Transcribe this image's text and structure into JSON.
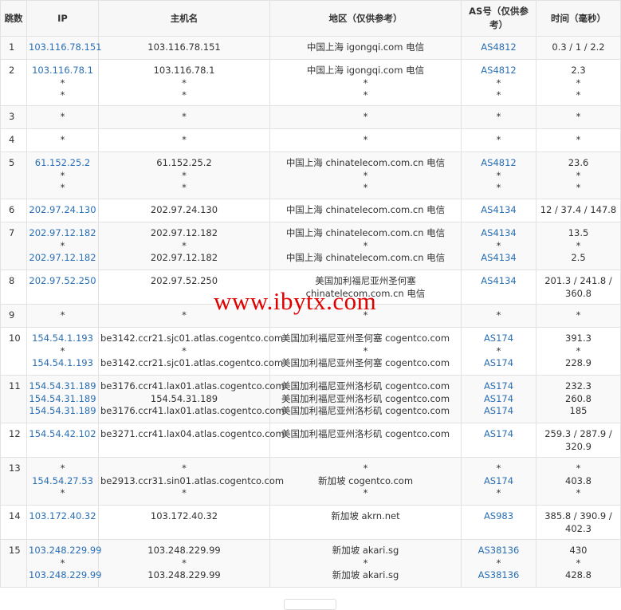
{
  "headers": {
    "hop": "跳数",
    "ip": "IP",
    "host": "主机名",
    "region": "地区（仅供参考）",
    "as": "AS号（仅供参考）",
    "time": "时间（毫秒）"
  },
  "rows": [
    {
      "hop": "1",
      "h": 29,
      "ip": [
        "103.116.78.151"
      ],
      "host": [
        "103.116.78.151"
      ],
      "region": [
        "中国上海 igongqi.com 电信"
      ],
      "as": [
        "AS4812"
      ],
      "time": [
        "0.3 / 1 / 2.2"
      ]
    },
    {
      "hop": "2",
      "h": 58,
      "ip": [
        "103.116.78.1",
        "*",
        "*"
      ],
      "host": [
        "103.116.78.1",
        "*",
        "*"
      ],
      "region": [
        "中国上海 igongqi.com 电信",
        "*",
        "*"
      ],
      "as": [
        "AS4812",
        "*",
        "*"
      ],
      "time": [
        "2.3",
        "*",
        "*"
      ]
    },
    {
      "hop": "3",
      "h": 29,
      "ip": [
        "*"
      ],
      "host": [
        "*"
      ],
      "region": [
        "*"
      ],
      "as": [
        "*"
      ],
      "time": [
        "*"
      ]
    },
    {
      "hop": "4",
      "h": 29,
      "ip": [
        "*"
      ],
      "host": [
        "*"
      ],
      "region": [
        "*"
      ],
      "as": [
        "*"
      ],
      "time": [
        "*"
      ]
    },
    {
      "hop": "5",
      "h": 59,
      "ip": [
        "61.152.25.2",
        "*",
        "*"
      ],
      "host": [
        "61.152.25.2",
        "*",
        "*"
      ],
      "region": [
        "中国上海 chinatelecom.com.cn 电信",
        "*",
        "*"
      ],
      "as": [
        "AS4812",
        "*",
        "*"
      ],
      "time": [
        "23.6",
        "*",
        "*"
      ]
    },
    {
      "hop": "6",
      "h": 29,
      "ip": [
        "202.97.24.130"
      ],
      "host": [
        "202.97.24.130"
      ],
      "region": [
        "中国上海 chinatelecom.com.cn 电信"
      ],
      "as": [
        "AS4134"
      ],
      "time": [
        "12 / 37.4 / 147.8"
      ]
    },
    {
      "hop": "7",
      "h": 60,
      "ip": [
        "202.97.12.182",
        "*",
        "202.97.12.182"
      ],
      "host": [
        "202.97.12.182",
        "*",
        "202.97.12.182"
      ],
      "region": [
        "中国上海 chinatelecom.com.cn 电信",
        "*",
        "中国上海 chinatelecom.com.cn 电信"
      ],
      "as": [
        "AS4134",
        "*",
        "AS4134"
      ],
      "time": [
        "13.5",
        "*",
        "2.5"
      ]
    },
    {
      "hop": "8",
      "h": 43,
      "ip": [
        "202.97.52.250"
      ],
      "host": [
        "202.97.52.250"
      ],
      "region": [
        "美国加利福尼亚州圣何塞",
        "chinatelecom.com.cn 电信"
      ],
      "as": [
        "AS4134"
      ],
      "time": [
        "201.3 / 241.8 /",
        "360.8"
      ]
    },
    {
      "hop": "9",
      "h": 29,
      "ip": [
        "*"
      ],
      "host": [
        "*"
      ],
      "region": [
        "*"
      ],
      "as": [
        "*"
      ],
      "time": [
        "*"
      ]
    },
    {
      "hop": "10",
      "h": 60,
      "ip": [
        "154.54.1.193",
        "*",
        "154.54.1.193"
      ],
      "host": [
        "be3142.ccr21.sjc01.atlas.cogentco.com",
        "*",
        "be3142.ccr21.sjc01.atlas.cogentco.com"
      ],
      "region": [
        "美国加利福尼亚州圣何塞 cogentco.com",
        "*",
        "美国加利福尼亚州圣何塞 cogentco.com"
      ],
      "as": [
        "AS174",
        "*",
        "AS174"
      ],
      "time": [
        "391.3",
        "*",
        "228.9"
      ]
    },
    {
      "hop": "11",
      "h": 60,
      "ip": [
        "154.54.31.189",
        "154.54.31.189",
        "154.54.31.189"
      ],
      "host": [
        "be3176.ccr41.lax01.atlas.cogentco.com",
        "154.54.31.189",
        "be3176.ccr41.lax01.atlas.cogentco.com"
      ],
      "region": [
        "美国加利福尼亚州洛杉矶 cogentco.com",
        "美国加利福尼亚州洛杉矶 cogentco.com",
        "美国加利福尼亚州洛杉矶 cogentco.com"
      ],
      "as": [
        "AS174",
        "AS174",
        "AS174"
      ],
      "time": [
        "232.3",
        "260.8",
        "185"
      ]
    },
    {
      "hop": "12",
      "h": 43,
      "ip": [
        "154.54.42.102"
      ],
      "host": [
        "be3271.ccr41.lax04.atlas.cogentco.com"
      ],
      "region": [
        "美国加利福尼亚州洛杉矶 cogentco.com"
      ],
      "as": [
        "AS174"
      ],
      "time": [
        "259.3 / 287.9 /",
        "320.9"
      ]
    },
    {
      "hop": "13",
      "h": 60,
      "ip": [
        "*",
        "154.54.27.53",
        "*"
      ],
      "host": [
        "*",
        "be2913.ccr31.sin01.atlas.cogentco.com",
        "*"
      ],
      "region": [
        "*",
        "新加坡 cogentco.com",
        "*"
      ],
      "as": [
        "*",
        "AS174",
        "*"
      ],
      "time": [
        "*",
        "403.8",
        "*"
      ]
    },
    {
      "hop": "14",
      "h": 43,
      "ip": [
        "103.172.40.32"
      ],
      "host": [
        "103.172.40.32"
      ],
      "region": [
        "新加坡 akrn.net"
      ],
      "as": [
        "AS983"
      ],
      "time": [
        "385.8 / 390.9 /",
        "402.3"
      ]
    },
    {
      "hop": "15",
      "h": 60,
      "ip": [
        "103.248.229.99",
        "*",
        "103.248.229.99"
      ],
      "host": [
        "103.248.229.99",
        "*",
        "103.248.229.99"
      ],
      "region": [
        "新加坡 akari.sg",
        "*",
        "新加坡 akari.sg"
      ],
      "as": [
        "AS38136",
        "*",
        "AS38136"
      ],
      "time": [
        "430",
        "*",
        "428.8"
      ]
    }
  ],
  "watermark": "www.ibytx.com",
  "colors": {
    "link": "#2a6fb5",
    "watermark": "#e00000",
    "header_bg": "#f7f7f7",
    "border": "#e2e2e2"
  }
}
